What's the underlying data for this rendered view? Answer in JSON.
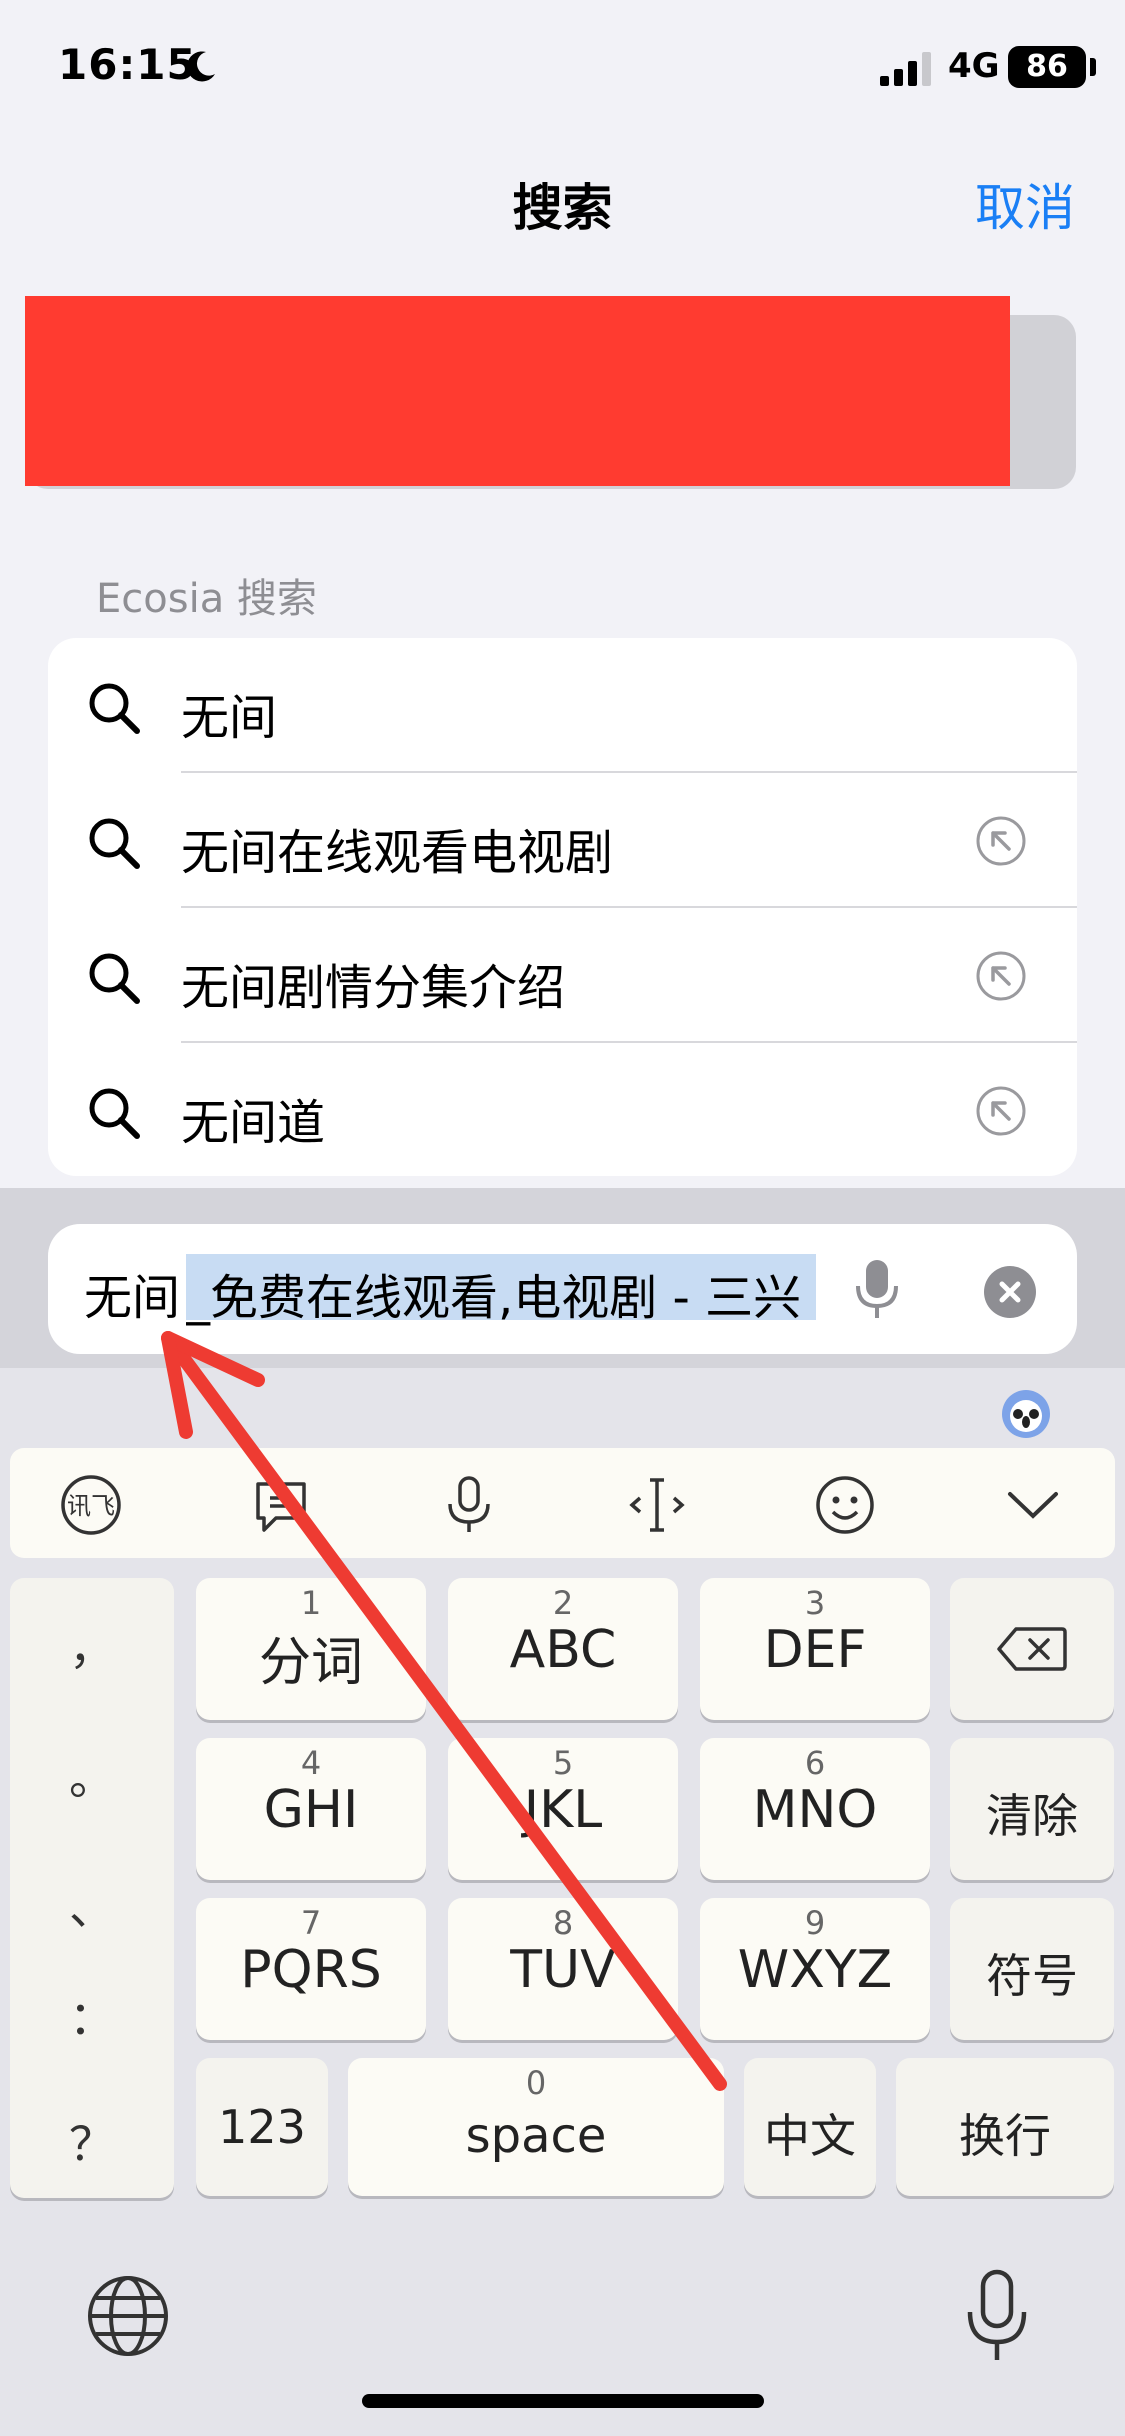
{
  "status_bar": {
    "time": "16:15",
    "network": "4G",
    "battery": "86"
  },
  "header": {
    "title": "搜索",
    "cancel_label": "取消"
  },
  "suggestions": {
    "section_label": "Ecosia 搜索",
    "items": [
      {
        "text": "无间"
      },
      {
        "text": "无间在线观看电视剧"
      },
      {
        "text": "无间剧情分集介绍"
      },
      {
        "text": "无间道"
      }
    ]
  },
  "search_input": {
    "typed": "无间",
    "autocomplete": "_免费在线观看,电视剧 - 三兴"
  },
  "keyboard": {
    "punctuation": [
      "，",
      "。",
      "、",
      "：",
      "？"
    ],
    "keys": [
      {
        "num": "1",
        "label": "分词"
      },
      {
        "num": "2",
        "label": "ABC"
      },
      {
        "num": "3",
        "label": "DEF"
      },
      {
        "num": "4",
        "label": "GHI"
      },
      {
        "num": "5",
        "label": "JKL"
      },
      {
        "num": "6",
        "label": "MNO"
      },
      {
        "num": "7",
        "label": "PQRS"
      },
      {
        "num": "8",
        "label": "TUV"
      },
      {
        "num": "9",
        "label": "WXYZ"
      }
    ],
    "clear_label": "清除",
    "symbols_label": "符号",
    "num_mode_label": "123",
    "space_num": "0",
    "space_label": "space",
    "lang_label": "中文",
    "return_label": "换行"
  },
  "colors": {
    "accent": "#1a7ff5",
    "redaction": "#ff3b30",
    "annotation": "#ee3b32"
  }
}
